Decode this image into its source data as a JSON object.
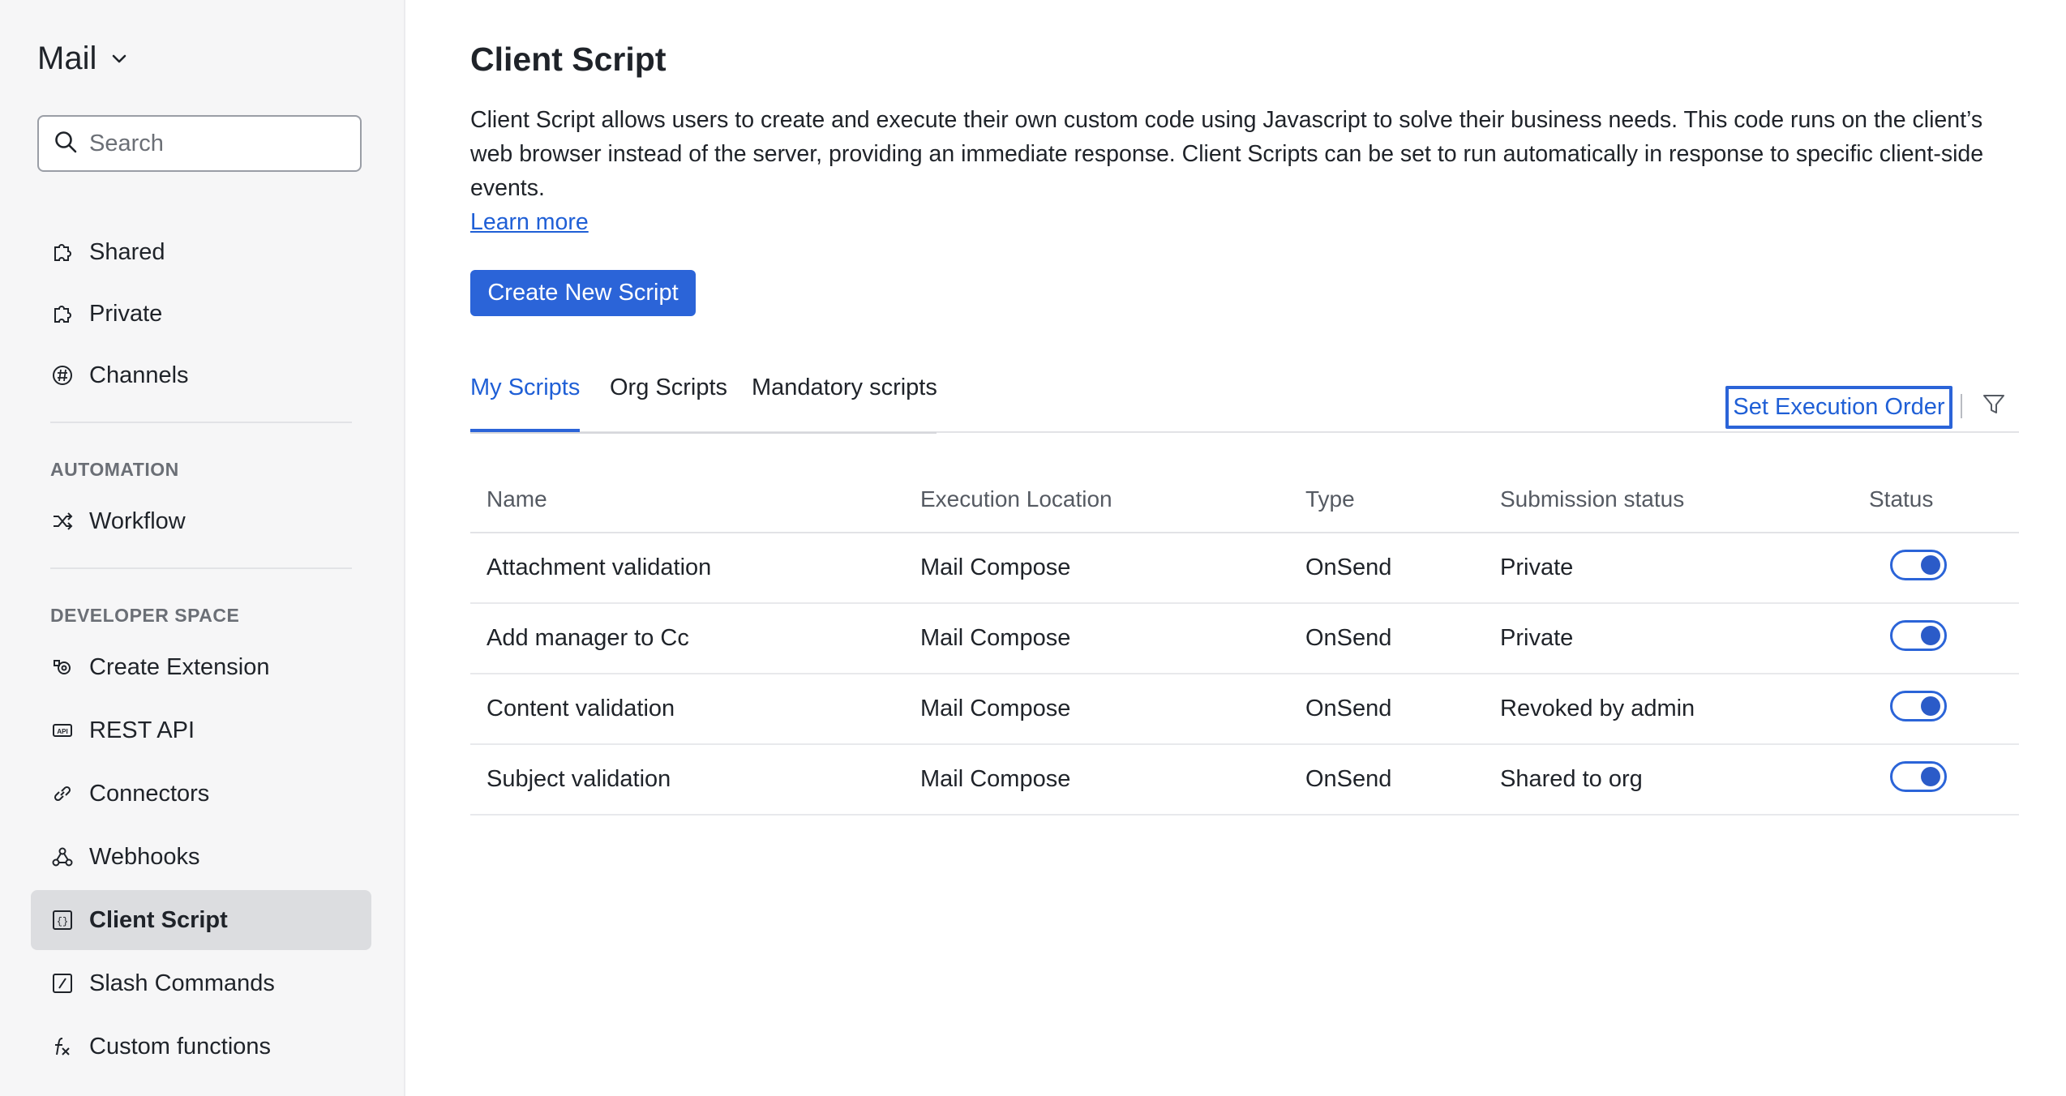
{
  "sidebar": {
    "app_title": "Mail",
    "search_placeholder": "Search",
    "items_top": [
      {
        "label": "Shared",
        "icon": "shared-puzzle-icon"
      },
      {
        "label": "Private",
        "icon": "private-puzzle-icon"
      },
      {
        "label": "Channels",
        "icon": "channels-icon"
      }
    ],
    "automation_label": "AUTOMATION",
    "automation_items": [
      {
        "label": "Workflow",
        "icon": "shuffle-icon"
      }
    ],
    "developer_label": "DEVELOPER SPACE",
    "developer_items": [
      {
        "label": "Create Extension",
        "icon": "extension-icon"
      },
      {
        "label": "REST API",
        "icon": "api-icon"
      },
      {
        "label": "Connectors",
        "icon": "link-icon"
      },
      {
        "label": "Webhooks",
        "icon": "webhook-icon"
      },
      {
        "label": "Client Script",
        "icon": "client-script-icon",
        "active": true
      },
      {
        "label": "Slash Commands",
        "icon": "slash-icon"
      },
      {
        "label": "Custom functions",
        "icon": "function-icon"
      }
    ]
  },
  "main": {
    "title": "Client Script",
    "description": "Client Script allows users to create and execute their own custom code using Javascript to solve their business needs. This code runs on the client’s web browser instead of the server, providing an immediate response. Client Scripts can be set to run automatically in response to specific client-side events.",
    "learn_more": "Learn more",
    "create_button": "Create New Script",
    "tabs": [
      {
        "label": "My Scripts",
        "active": true
      },
      {
        "label": "Org Scripts"
      },
      {
        "label": "Mandatory scripts"
      }
    ],
    "set_execution_order": "Set Execution Order",
    "table": {
      "headers": [
        "Name",
        "Execution Location",
        "Type",
        "Submission status",
        "Status"
      ],
      "rows": [
        {
          "name": "Attachment validation",
          "location": "Mail Compose",
          "type": "OnSend",
          "submission": "Private",
          "enabled": true
        },
        {
          "name": "Add manager to Cc",
          "location": "Mail Compose",
          "type": "OnSend",
          "submission": "Private",
          "enabled": true
        },
        {
          "name": "Content validation",
          "location": "Mail Compose",
          "type": "OnSend",
          "submission": "Revoked by admin",
          "enabled": true
        },
        {
          "name": "Subject validation",
          "location": "Mail Compose",
          "type": "OnSend",
          "submission": "Shared to org",
          "enabled": true
        }
      ]
    }
  },
  "colors": {
    "accent": "#2b64d8",
    "link": "#1f5fd6",
    "sidebar_bg": "#f6f6f7",
    "active_item_bg": "#dcdde0"
  }
}
